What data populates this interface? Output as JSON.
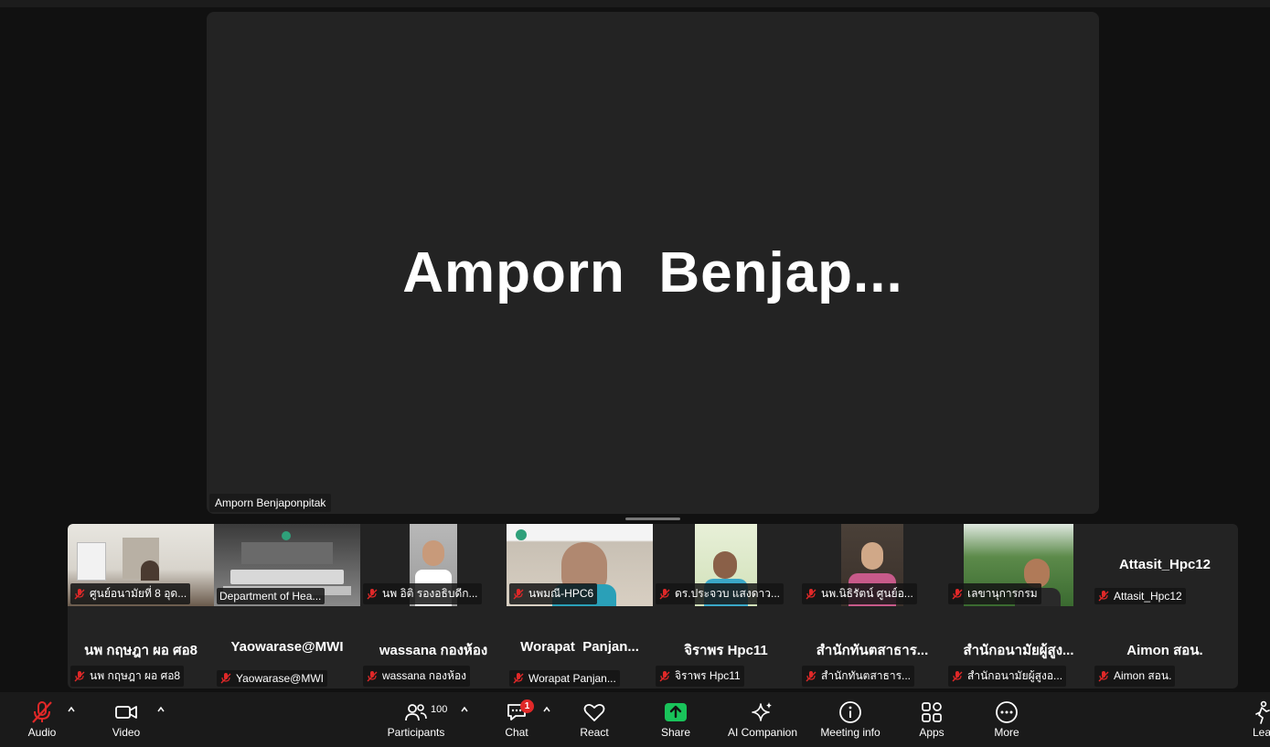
{
  "speaker": {
    "display_name": "Amporn  Benjap...",
    "label": "Amporn Benjaponpitak"
  },
  "gallery": {
    "row1": [
      {
        "label": "ศูนย์อนามัยที่ 8 อุด..."
      },
      {
        "label": "Department of Hea..."
      },
      {
        "label": "นพ อิติ รองอธิบดีก..."
      },
      {
        "label": "นพมณี-HPC6"
      },
      {
        "label": "ดร.ประจวบ แสงดาว..."
      },
      {
        "label": "นพ.นิธิรัตน์ ศูนย์อ..."
      },
      {
        "label": "เลขานุการกรม"
      },
      {
        "name": "Attasit_Hpc12",
        "label": "Attasit_Hpc12"
      }
    ],
    "row2": [
      {
        "name": "นพ กฤษฎา ผอ ศอ8",
        "label": "นพ กฤษฎา ผอ ศอ8"
      },
      {
        "name": "Yaowarase@MWI",
        "label": "Yaowarase@MWI"
      },
      {
        "name": "wassana กองห้อง",
        "label": "wassana กองห้อง"
      },
      {
        "name": "Worapat  Panjan...",
        "label": "Worapat Panjan..."
      },
      {
        "name": "จิราพร Hpc11",
        "label": "จิราพร Hpc11"
      },
      {
        "name": "สำนักทันตสาธาร...",
        "label": "สำนักทันตสาธาร..."
      },
      {
        "name": "สำนักอนามัยผู้สูง...",
        "label": "สำนักอนามัยผู้สูงอ..."
      },
      {
        "name": "Aimon สอน.",
        "label": "Aimon สอน."
      }
    ]
  },
  "toolbar": {
    "audio": "Audio",
    "video": "Video",
    "participants": "Participants",
    "participants_count": "100",
    "chat": "Chat",
    "chat_badge": "1",
    "react": "React",
    "share": "Share",
    "ai_companion": "AI Companion",
    "meeting_info": "Meeting info",
    "apps": "Apps",
    "more": "More",
    "leave": "Lea"
  },
  "colors": {
    "background": "#111111",
    "tile": "#232323",
    "share_green": "#19c35a",
    "mute_red": "#e02828"
  }
}
